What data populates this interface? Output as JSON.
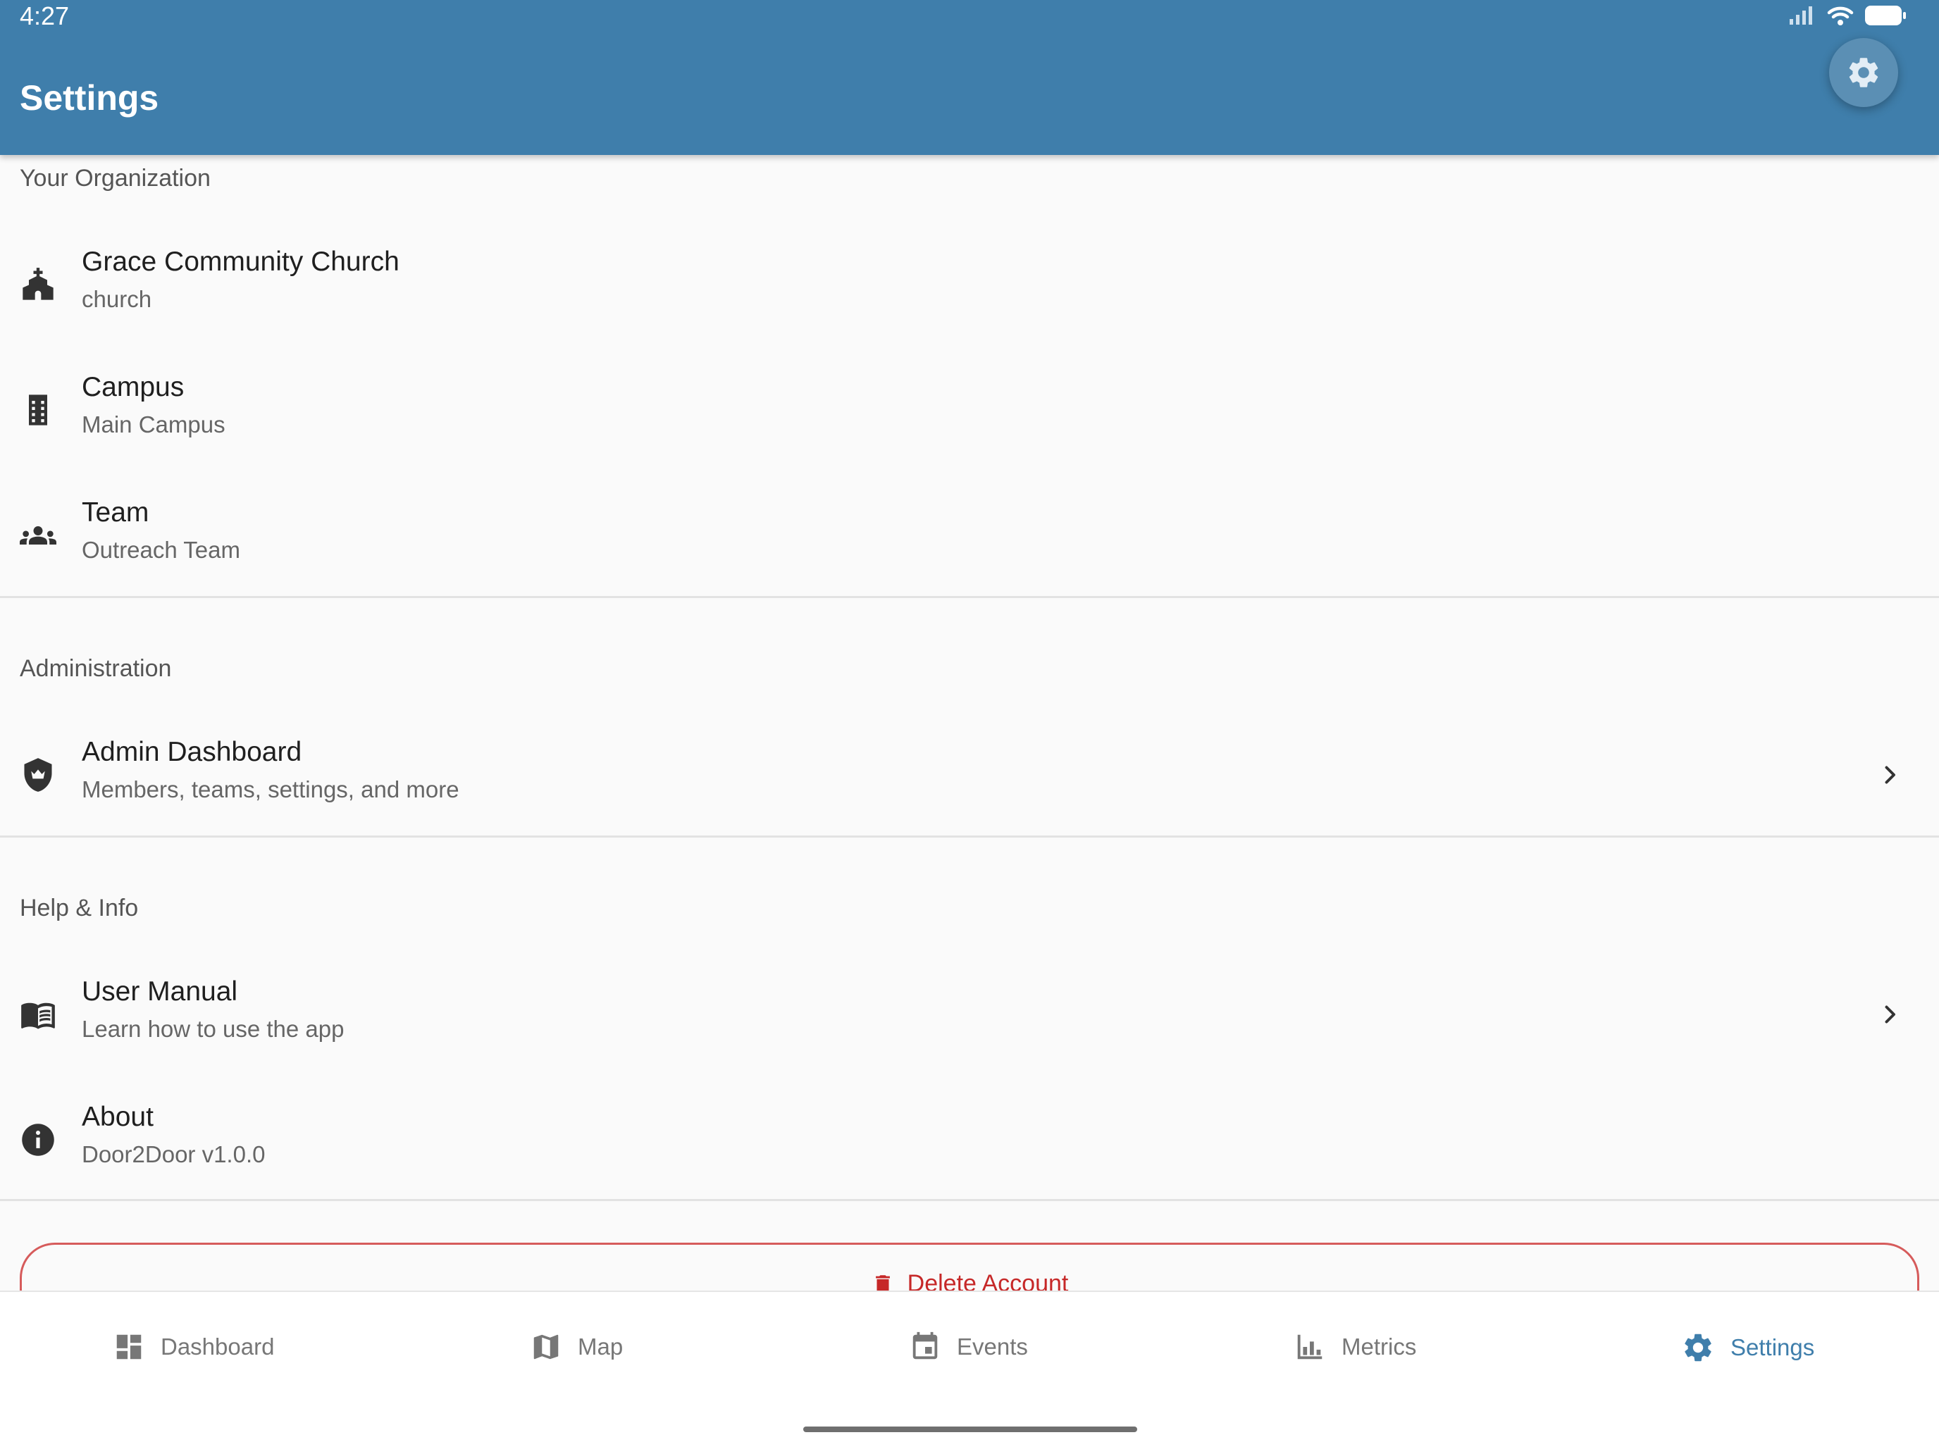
{
  "status": {
    "time": "4:27"
  },
  "header": {
    "title": "Settings"
  },
  "sections": {
    "organization": {
      "label": "Your Organization",
      "items": [
        {
          "title": "Grace Community Church",
          "subtitle": "church",
          "icon": "church-icon"
        },
        {
          "title": "Campus",
          "subtitle": "Main Campus",
          "icon": "building-icon"
        },
        {
          "title": "Team",
          "subtitle": "Outreach Team",
          "icon": "group-icon"
        }
      ]
    },
    "administration": {
      "label": "Administration",
      "items": [
        {
          "title": "Admin Dashboard",
          "subtitle": "Members, teams, settings, and more",
          "icon": "admin-shield-icon"
        }
      ]
    },
    "help": {
      "label": "Help & Info",
      "items": [
        {
          "title": "User Manual",
          "subtitle": "Learn how to use the app",
          "icon": "book-icon"
        },
        {
          "title": "About",
          "subtitle": "Door2Door v1.0.0",
          "icon": "info-icon"
        }
      ]
    }
  },
  "delete_account": {
    "label": "Delete Account",
    "color": "#c62828"
  },
  "bottom_nav": {
    "items": [
      {
        "label": "Dashboard",
        "icon": "dashboard-icon"
      },
      {
        "label": "Map",
        "icon": "map-icon"
      },
      {
        "label": "Events",
        "icon": "calendar-icon"
      },
      {
        "label": "Metrics",
        "icon": "bar-chart-icon"
      },
      {
        "label": "Settings",
        "icon": "gear-icon",
        "active": true
      }
    ]
  },
  "colors": {
    "primary": "#3f7eab",
    "background": "#fafafa",
    "danger": "#c62828"
  }
}
